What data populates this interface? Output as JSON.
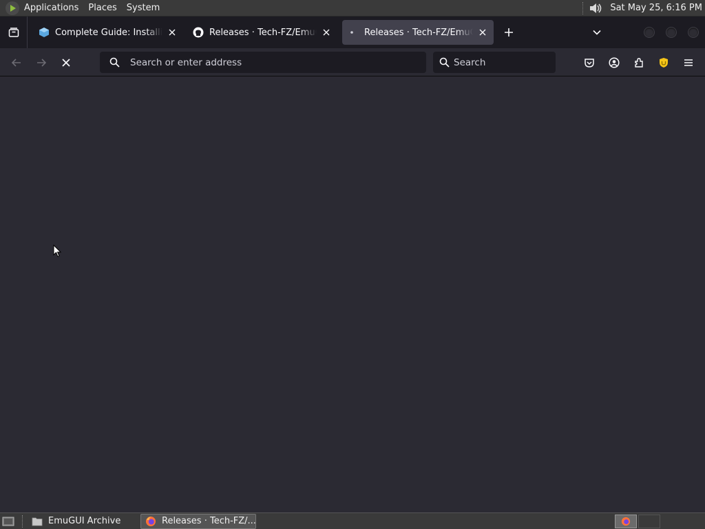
{
  "top_panel": {
    "menu": [
      "Applications",
      "Places",
      "System"
    ],
    "clock": "Sat May 25,  6:16 PM"
  },
  "tabs": [
    {
      "label": "Complete Guide: Installing and",
      "icon": "puzzle-cube-icon",
      "active": false
    },
    {
      "label": "Releases · Tech-FZ/EmuGUI",
      "icon": "github-icon",
      "active": false
    },
    {
      "label": "Releases · Tech-FZ/EmuGUI",
      "icon": "loading-dot-icon",
      "active": true
    }
  ],
  "navbar": {
    "address_placeholder": "Search or enter address",
    "search_placeholder": "Search"
  },
  "taskbar": {
    "tasks": [
      {
        "label": "EmuGUI Archive",
        "icon": "folder-icon",
        "active": false
      },
      {
        "label": "Releases · Tech-FZ/...",
        "icon": "firefox-icon",
        "active": true
      }
    ]
  },
  "colors": {
    "content_bg": "#2b2a33",
    "tabbar_bg": "#1c1b22",
    "active_tab_bg": "#42414d",
    "panel_bg": "#3a3a3a",
    "vpn_shield": "#f5c518"
  }
}
